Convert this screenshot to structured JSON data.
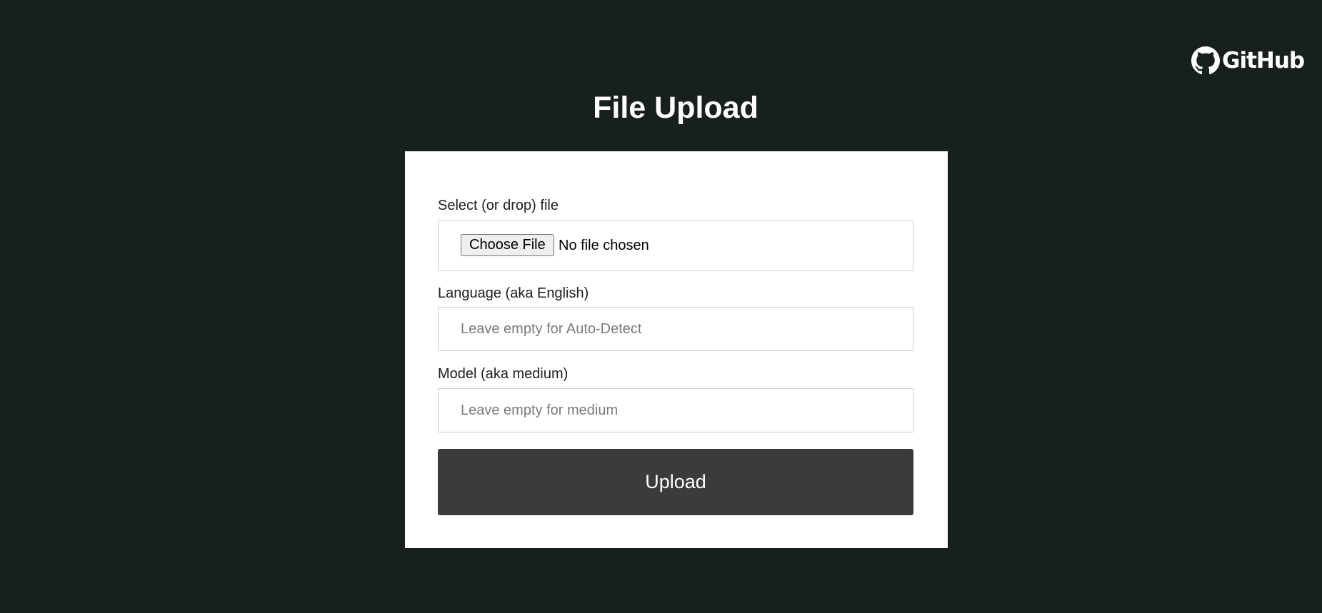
{
  "header": {
    "github_label": "GitHub",
    "github_icon": "github-octocat-icon"
  },
  "page": {
    "title": "File Upload"
  },
  "form": {
    "file": {
      "label": "Select (or drop) file",
      "button_label": "Choose File",
      "status": "No file chosen"
    },
    "language": {
      "label": "Language (aka English)",
      "value": "",
      "placeholder": "Leave empty for Auto-Detect"
    },
    "model": {
      "label": "Model (aka medium)",
      "value": "",
      "placeholder": "Leave empty for medium"
    },
    "submit_label": "Upload"
  },
  "colors": {
    "background": "#171f1f",
    "card": "#ffffff",
    "button": "#3c3a3b",
    "text_light": "#ffffff"
  }
}
